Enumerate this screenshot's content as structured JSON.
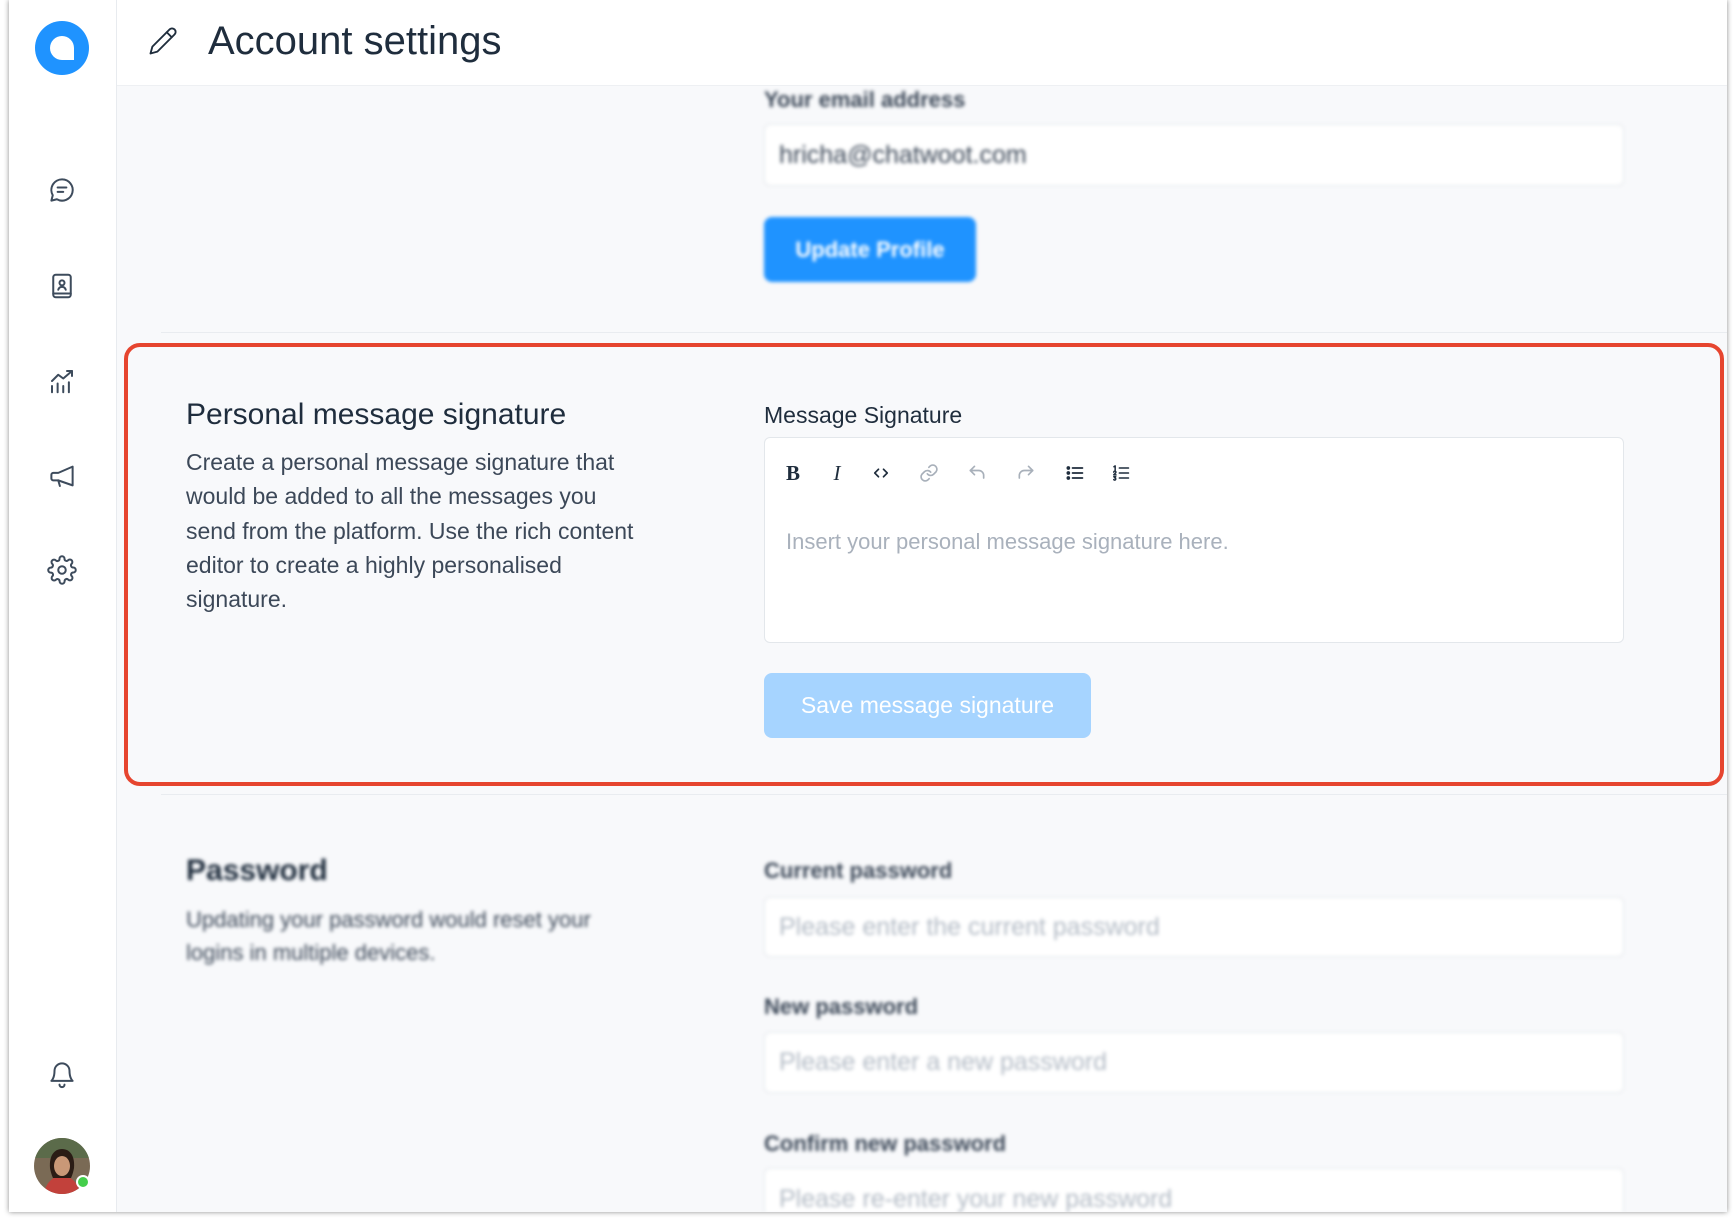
{
  "colors": {
    "primary": "#1f93ff",
    "primary_disabled": "#a6d4ff",
    "highlight_border": "#e6452f",
    "online_status": "#44ce4b"
  },
  "sidebar": {
    "logo_icon": "chatwoot-logo-icon",
    "nav_icons": [
      "chat-icon",
      "contacts-icon",
      "reports-icon",
      "campaigns-icon",
      "settings-icon"
    ],
    "footer_icons": [
      "bell-icon",
      "avatar"
    ]
  },
  "header": {
    "icon": "pencil-icon",
    "title": "Account settings"
  },
  "profile": {
    "email_label": "Your email address",
    "email_value": "hricha@chatwoot.com",
    "update_button": "Update Profile"
  },
  "signature": {
    "title": "Personal message signature",
    "description_lines": [
      "Create a personal message signature that",
      "would be added to all the messages you",
      "send from the platform. Use the rich content",
      "editor to create a highly personalised",
      "signature."
    ],
    "field_label": "Message Signature",
    "toolbar": {
      "bold": "B",
      "italic": "I",
      "icons": [
        "code-icon",
        "link-icon",
        "undo-icon",
        "redo-icon",
        "bullet-list-icon",
        "ordered-list-icon"
      ]
    },
    "placeholder": "Insert your personal message signature here.",
    "save_button": "Save message signature"
  },
  "password": {
    "title": "Password",
    "description_lines": [
      "Updating your password would reset your",
      "logins in multiple devices."
    ],
    "fields": [
      {
        "label": "Current password",
        "placeholder": "Please enter the current password"
      },
      {
        "label": "New password",
        "placeholder": "Please enter a new password"
      },
      {
        "label": "Confirm new password",
        "placeholder": "Please re-enter your new password"
      }
    ]
  }
}
